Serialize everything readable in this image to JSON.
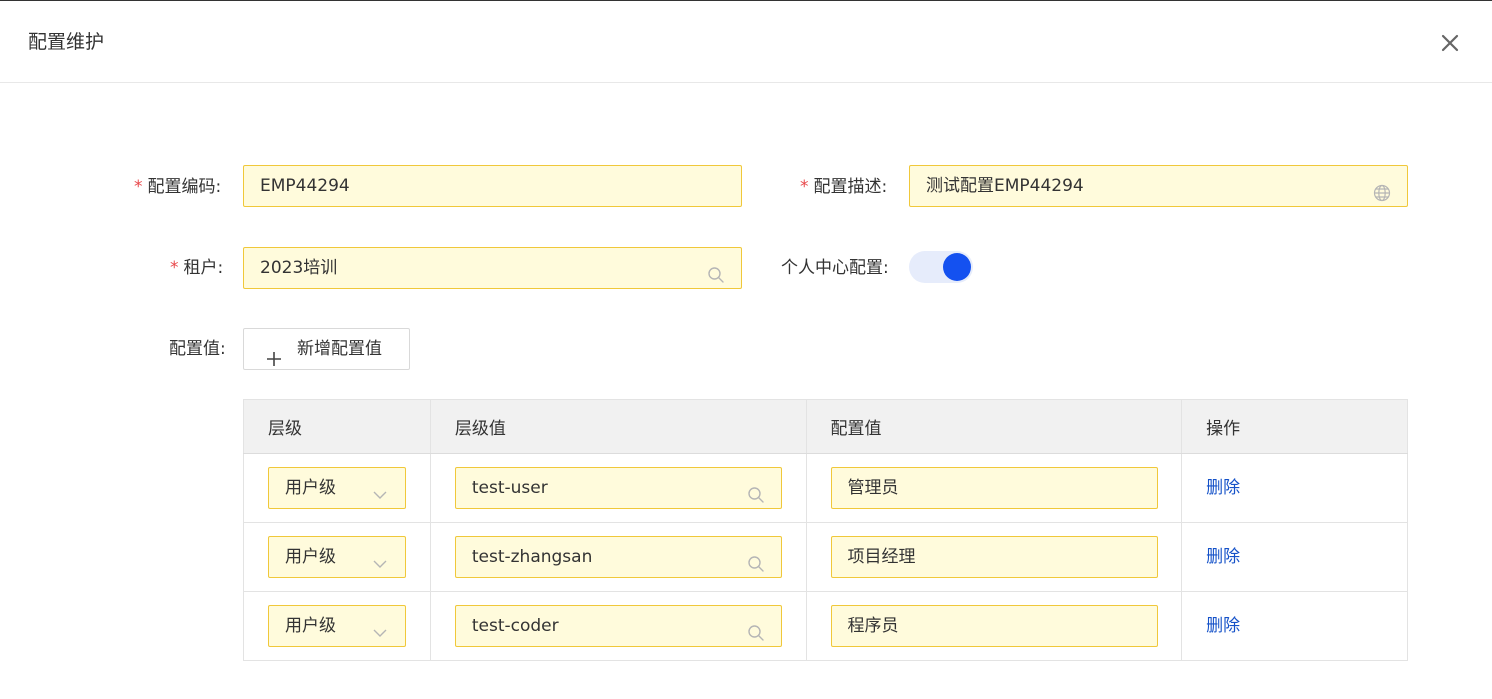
{
  "dialog": {
    "title": "配置维护",
    "close_icon": "close-icon"
  },
  "form": {
    "config_code": {
      "label": "配置编码:",
      "required": "*",
      "value": "EMP44294"
    },
    "config_desc": {
      "label": "配置描述:",
      "required": "*",
      "value": "测试配置EMP44294",
      "icon": "globe-icon"
    },
    "tenant": {
      "label": "租户:",
      "required": "*",
      "value": "2023培训",
      "icon": "search-icon"
    },
    "personal_center": {
      "label": "个人中心配置:",
      "enabled": true
    },
    "config_values": {
      "label": "配置值:",
      "add_button": "新增配置值",
      "add_icon": "plus-icon"
    }
  },
  "table": {
    "columns": [
      "层级",
      "层级值",
      "配置值",
      "操作"
    ],
    "rows": [
      {
        "level": "用户级",
        "level_value": "test-user",
        "config_value": "管理员",
        "action": "删除"
      },
      {
        "level": "用户级",
        "level_value": "test-zhangsan",
        "config_value": "项目经理",
        "action": "删除"
      },
      {
        "level": "用户级",
        "level_value": "test-coder",
        "config_value": "程序员",
        "action": "删除"
      }
    ]
  },
  "colors": {
    "accent": "#1451f0",
    "required": "#e8484b",
    "input_bg": "#fffbdc",
    "input_border": "#f0c83a",
    "link": "#1451c8"
  }
}
